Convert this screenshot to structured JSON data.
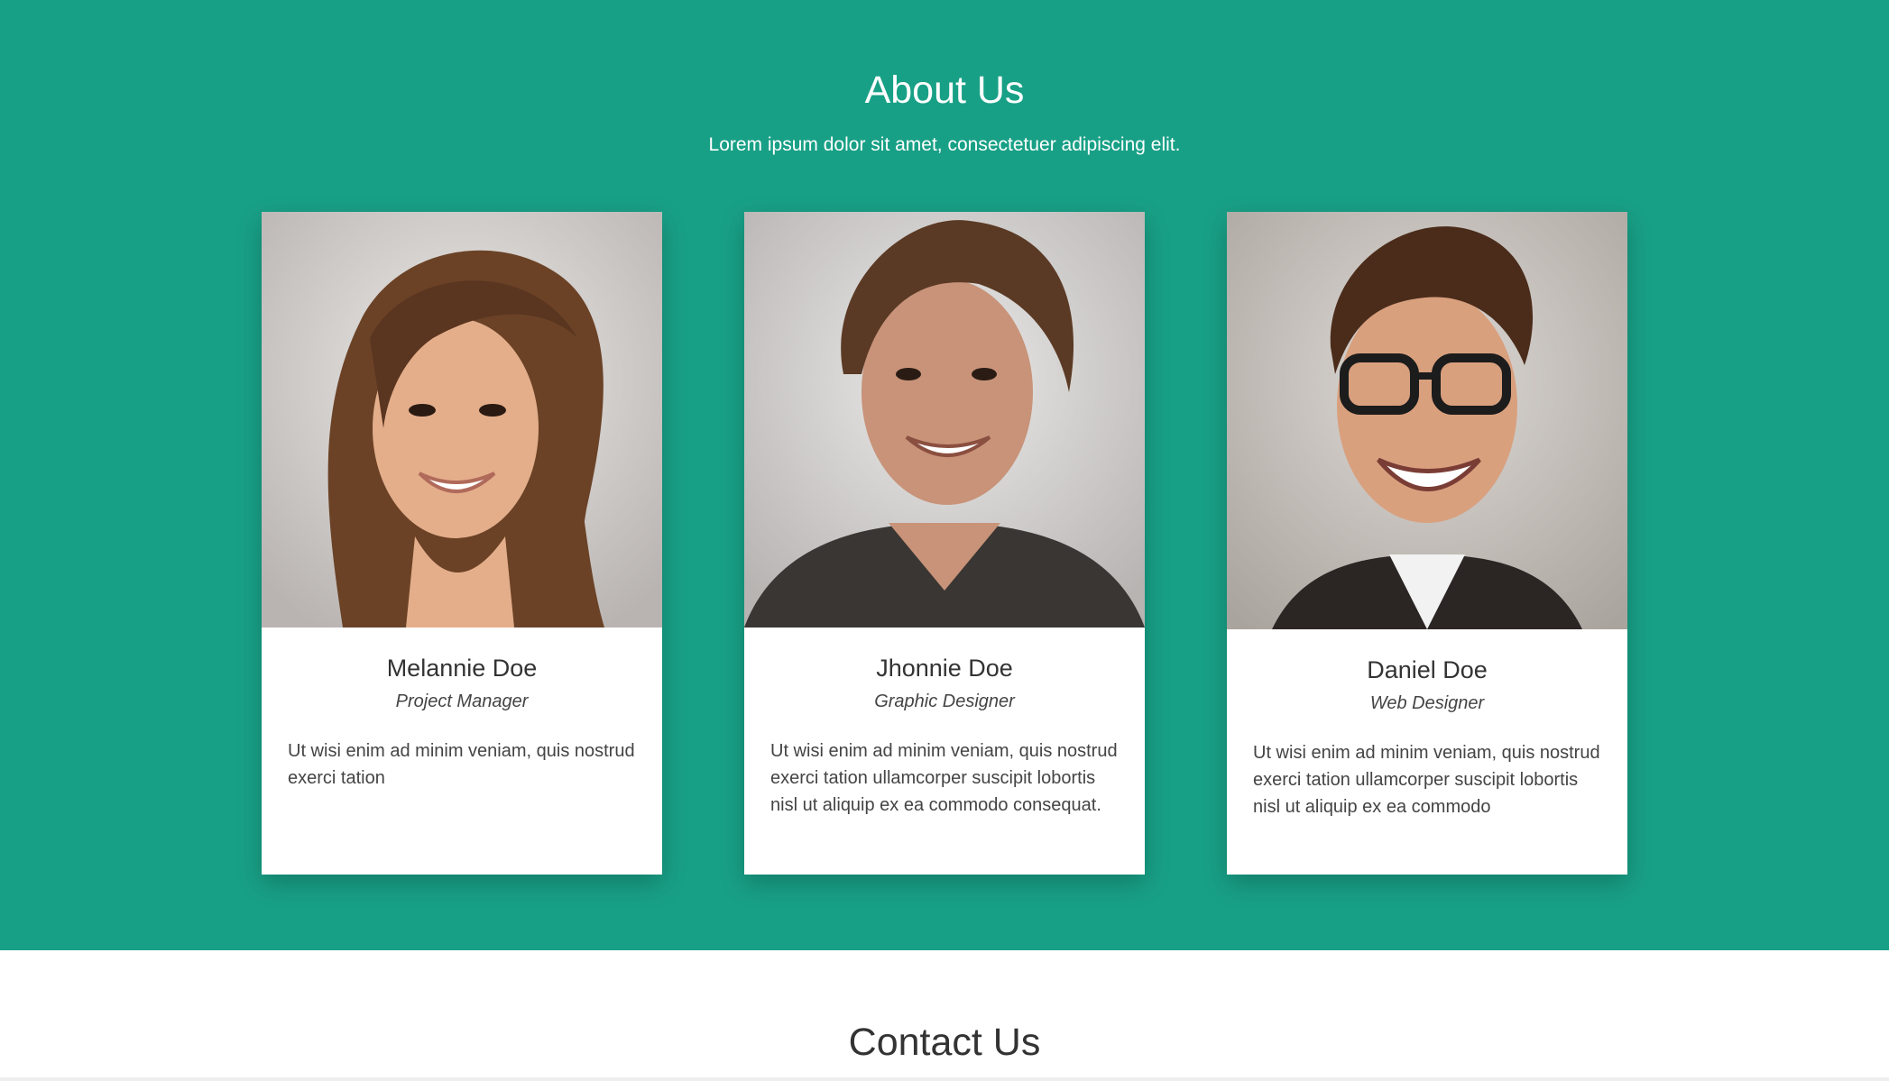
{
  "about": {
    "title": "About Us",
    "subtitle": "Lorem ipsum dolor sit amet, consectetuer adipiscing elit.",
    "background_color": "#18a086",
    "team": [
      {
        "name": "Melannie Doe",
        "role": "Project Manager",
        "bio": "Ut wisi enim ad minim veniam, quis nostrud exerci tation"
      },
      {
        "name": "Jhonnie Doe",
        "role": "Graphic Designer",
        "bio": "Ut wisi enim ad minim veniam, quis nostrud exerci tation ullamcorper suscipit lobortis nisl ut aliquip ex ea commodo consequat."
      },
      {
        "name": "Daniel Doe",
        "role": "Web Designer",
        "bio": "Ut wisi enim ad minim veniam, quis nostrud exerci tation ullamcorper suscipit lobortis nisl ut aliquip ex ea commodo"
      }
    ]
  },
  "contact": {
    "title": "Contact Us"
  }
}
